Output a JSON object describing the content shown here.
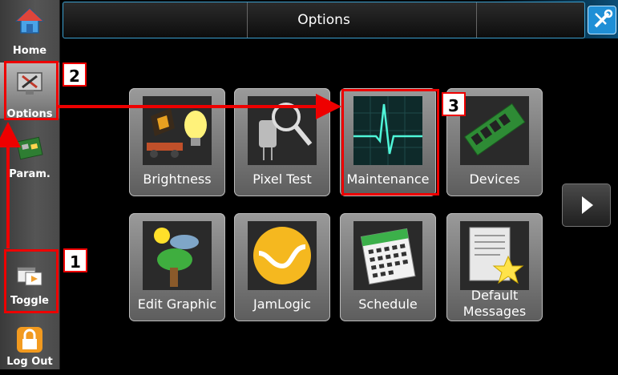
{
  "header": {
    "title": "Options"
  },
  "sidebar": {
    "items": [
      {
        "label": "Home",
        "icon": "home-icon"
      },
      {
        "label": "Options",
        "icon": "options-icon"
      },
      {
        "label": "Param.",
        "icon": "param-icon"
      },
      {
        "label": "Toggle",
        "icon": "toggle-icon"
      },
      {
        "label": "Log Out",
        "icon": "lock-icon"
      }
    ]
  },
  "tiles": [
    {
      "label": "Brightness",
      "icon": "brightness-icon"
    },
    {
      "label": "Pixel Test",
      "icon": "pixel-test-icon"
    },
    {
      "label": "Maintenance",
      "icon": "heartbeat-monitor-icon"
    },
    {
      "label": "Devices",
      "icon": "memory-module-icon"
    },
    {
      "label": "Edit Graphic",
      "icon": "edit-graphic-icon"
    },
    {
      "label": "JamLogic",
      "icon": "jamlogic-icon"
    },
    {
      "label": "Schedule",
      "icon": "calendar-icon"
    },
    {
      "label": "Default Messages",
      "label_line1": "Default",
      "label_line2": "Messages",
      "icon": "document-star-icon"
    }
  ],
  "callouts": [
    "1",
    "2",
    "3"
  ],
  "colors": {
    "highlight": "#e00000",
    "header_border": "#3aa0d0",
    "accent": "#1f8fd6"
  }
}
